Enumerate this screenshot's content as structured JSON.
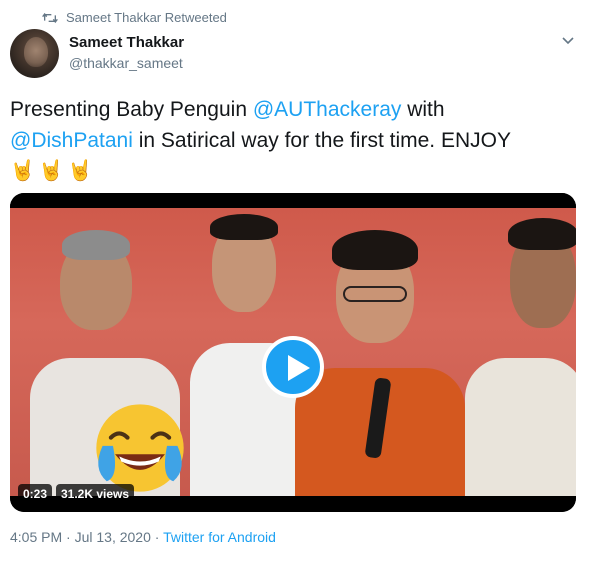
{
  "retweet": {
    "label": "Sameet Thakkar Retweeted",
    "icon": "retweet-icon"
  },
  "author": {
    "display_name": "Sameet Thakkar",
    "handle": "@thakkar_sameet"
  },
  "tweet": {
    "text_part1": "Presenting Baby Penguin ",
    "mention1": "@AUThackeray",
    "text_part2": " with",
    "mention2": "@DishPatani",
    "text_part3": " in Satirical way for the first time. ENJOY",
    "emojis": "🤘🤘🤘"
  },
  "media": {
    "duration": "0:23",
    "views": "31.2K views",
    "overlay_emoji": "face-with-tears-of-joy"
  },
  "meta": {
    "time": "4:05 PM",
    "separator1": " · ",
    "date": "Jul 13, 2020",
    "separator2": " · ",
    "source": "Twitter for Android"
  },
  "colors": {
    "accent": "#1da1f2",
    "secondary_text": "#657786",
    "primary_text": "#14171a"
  }
}
